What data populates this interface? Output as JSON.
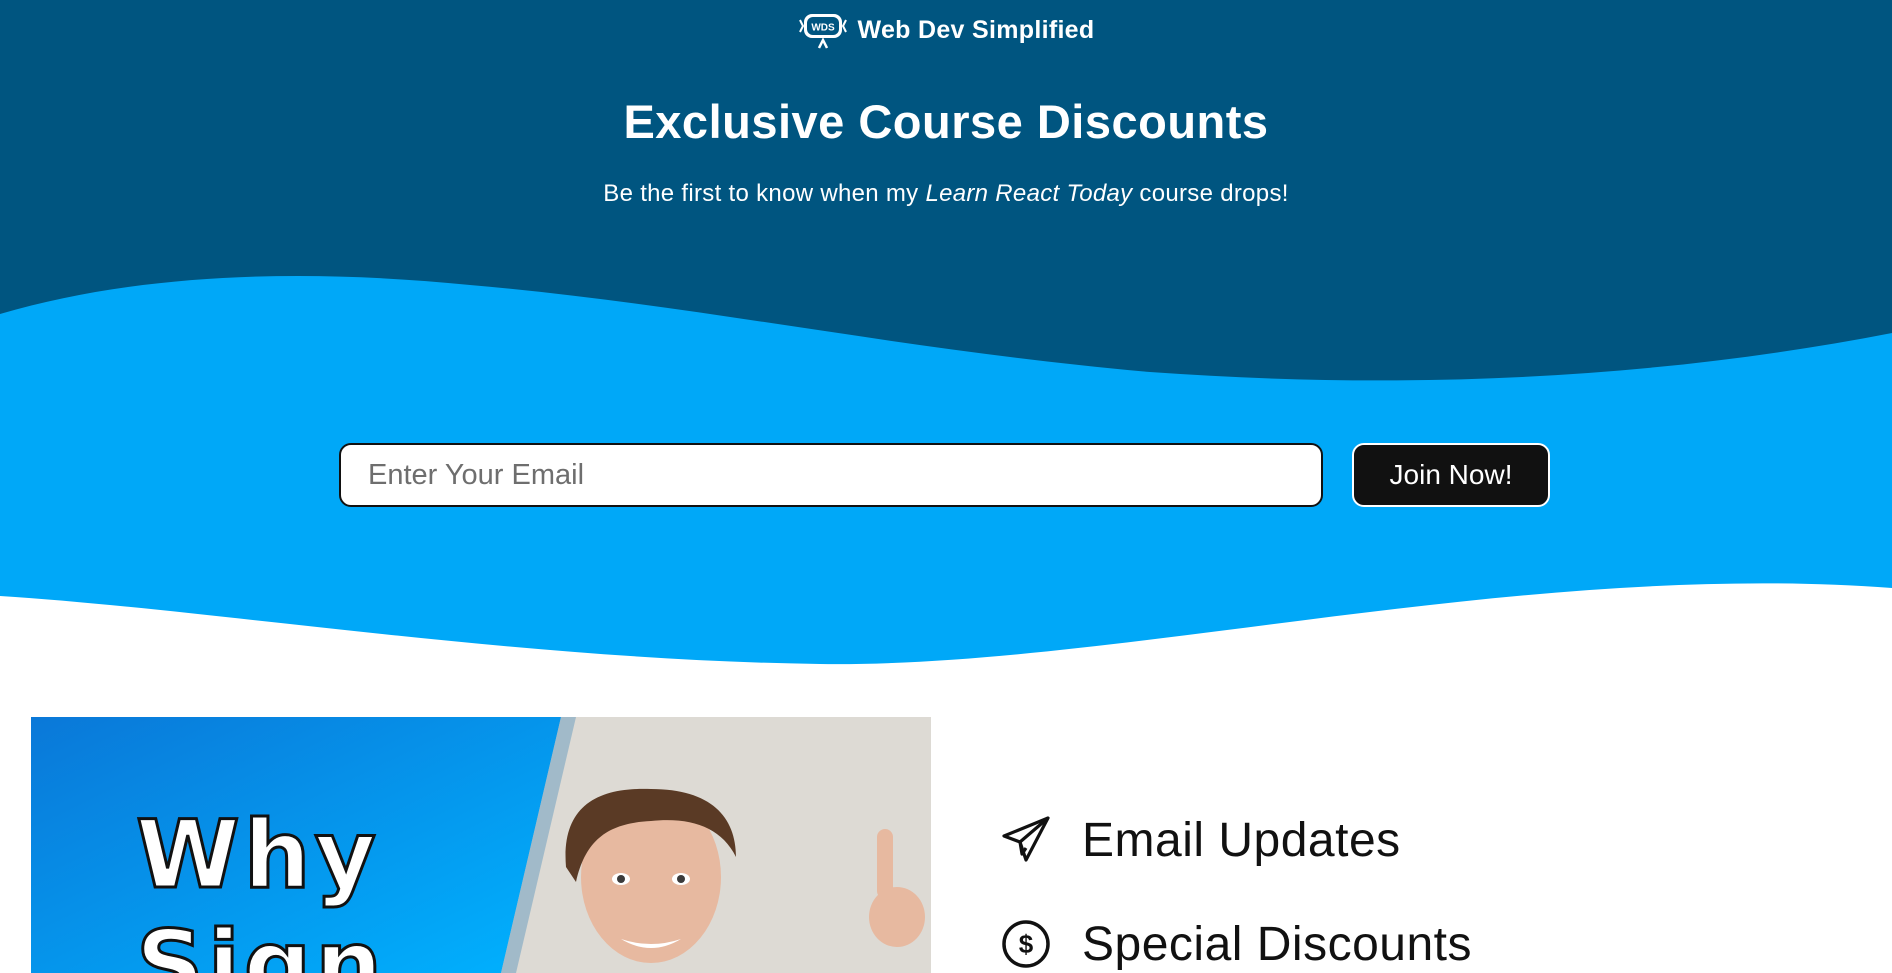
{
  "brand": {
    "logo_text": "WDS",
    "name": "Web Dev Simplified"
  },
  "hero": {
    "title": "Exclusive Course Discounts",
    "subtitle_before": "Be the first to know when my ",
    "subtitle_emphasis": "Learn React Today",
    "subtitle_after": " course drops!"
  },
  "signup": {
    "email_placeholder": "Enter Your Email",
    "email_value": "",
    "button_label": "Join Now!"
  },
  "promo": {
    "line1": "Why",
    "line2": "Sign"
  },
  "features": [
    {
      "label": "Email Updates",
      "icon": "paper-plane-icon"
    },
    {
      "label": "Special Discounts",
      "icon": "dollar-circle-icon"
    }
  ],
  "colors": {
    "header_dark_blue": "#005580",
    "light_blue": "#00a8f8",
    "button_black": "#111111",
    "text_white": "#ffffff"
  }
}
